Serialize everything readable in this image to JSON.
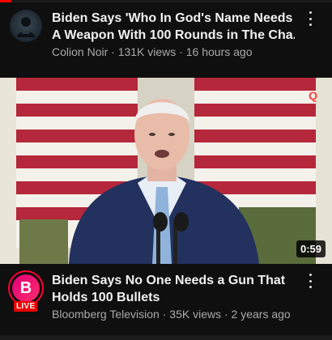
{
  "videos": [
    {
      "title_line1": "Biden Says 'Who In God's Name Needs",
      "title_line2": "A Weapon With 100 Rounds in The Cha...",
      "channel": "Colion Noir",
      "views": "131K views",
      "age": "16 hours ago",
      "avatar_icon": "silhouette-avatar-icon"
    },
    {
      "title_line1": "Biden Says No One Needs a Gun That",
      "title_line2": "Holds 100 Bullets",
      "channel": "Bloomberg Television",
      "views": "35K views",
      "age": "2 years ago",
      "avatar_letter": "B",
      "live_badge": "LIVE",
      "duration": "0:59"
    }
  ],
  "thumbnail": {
    "corner_mark": "Q"
  },
  "separator": "·",
  "colors": {
    "background": "#0f0f0f",
    "meta_text": "#aaaaaa",
    "live_red": "#ff0033"
  }
}
